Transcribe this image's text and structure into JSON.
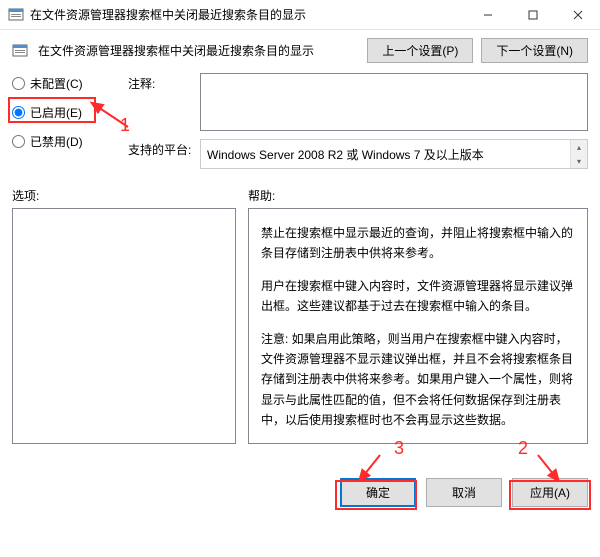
{
  "window": {
    "title": "在文件资源管理器搜索框中关闭最近搜索条目的显示"
  },
  "header": {
    "setting_title": "在文件资源管理器搜索框中关闭最近搜索条目的显示",
    "prev_button": "上一个设置(P)",
    "next_button": "下一个设置(N)"
  },
  "radios": {
    "not_configured": "未配置(C)",
    "enabled": "已启用(E)",
    "disabled": "已禁用(D)",
    "selected": "enabled"
  },
  "fields": {
    "comment_label": "注释:",
    "comment_value": "",
    "platform_label": "支持的平台:",
    "platform_value": "Windows Server 2008 R2 或 Windows 7 及以上版本"
  },
  "sections": {
    "options_label": "选项:",
    "help_label": "帮助:"
  },
  "help": {
    "p1": "禁止在搜索框中显示最近的查询，并阻止将搜索框中输入的条目存储到注册表中供将来参考。",
    "p2": "用户在搜索框中键入内容时，文件资源管理器将显示建议弹出框。这些建议都基于过去在搜索框中输入的条目。",
    "p3": "注意: 如果启用此策略，则当用户在搜索框中键入内容时，文件资源管理器不显示建议弹出框，并且不会将搜索框条目存储到注册表中供将来参考。如果用户键入一个属性，则将显示与此属性匹配的值，但不会将任何数据保存到注册表中，以后使用搜索框时也不会再显示这些数据。"
  },
  "footer": {
    "ok": "确定",
    "cancel": "取消",
    "apply": "应用(A)"
  },
  "annotations": {
    "n1": "1",
    "n2": "2",
    "n3": "3"
  }
}
